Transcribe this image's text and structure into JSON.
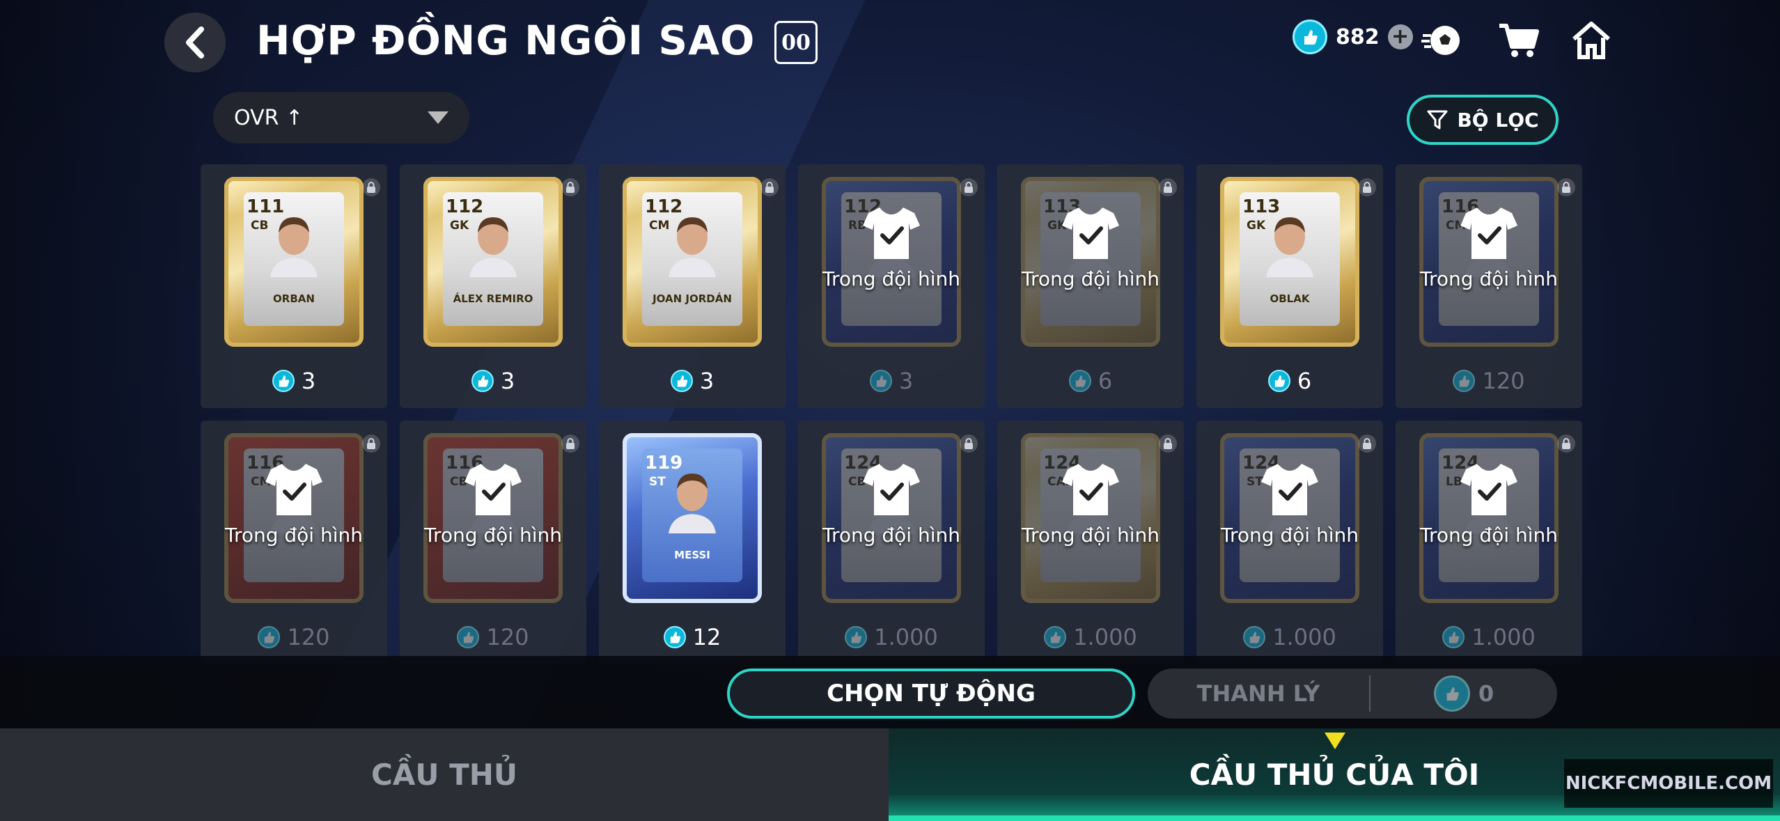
{
  "header": {
    "title": "HỢP ĐỒNG NGÔI SAO",
    "badge": "00",
    "currency_value": "882"
  },
  "sort": {
    "label": "OVR ↑"
  },
  "filter": {
    "label": "BỘ LỌC"
  },
  "in_squad_label": "Trong đội hình",
  "rows": [
    [
      {
        "ovr": "111",
        "pos": "CB",
        "name": "ORBAN",
        "price": "3",
        "in_squad": false,
        "style": "gold"
      },
      {
        "ovr": "112",
        "pos": "GK",
        "name": "ÁLEX REMIRO",
        "price": "3",
        "in_squad": false,
        "style": "gold"
      },
      {
        "ovr": "112",
        "pos": "CM",
        "name": "JOAN JORDÁN",
        "price": "3",
        "in_squad": false,
        "style": "gold"
      },
      {
        "ovr": "112",
        "pos": "RB",
        "name": "",
        "price": "3",
        "in_squad": true,
        "style": "blue"
      },
      {
        "ovr": "113",
        "pos": "GK",
        "name": "",
        "price": "6",
        "in_squad": true,
        "style": "gold"
      },
      {
        "ovr": "113",
        "pos": "GK",
        "name": "OBLAK",
        "price": "6",
        "in_squad": false,
        "style": "gold"
      },
      {
        "ovr": "116",
        "pos": "CM",
        "name": "",
        "price": "120",
        "in_squad": true,
        "style": "blue"
      }
    ],
    [
      {
        "ovr": "116",
        "pos": "CM",
        "name": "",
        "price": "120",
        "in_squad": true,
        "style": "red"
      },
      {
        "ovr": "116",
        "pos": "CB",
        "name": "",
        "price": "120",
        "in_squad": true,
        "style": "red"
      },
      {
        "ovr": "119",
        "pos": "ST",
        "name": "MESSI",
        "price": "12",
        "in_squad": false,
        "style": "messi"
      },
      {
        "ovr": "124",
        "pos": "CB",
        "name": "",
        "price": "1.000",
        "in_squad": true,
        "style": "blue"
      },
      {
        "ovr": "124",
        "pos": "CAM",
        "name": "",
        "price": "1.000",
        "in_squad": true,
        "style": "gold"
      },
      {
        "ovr": "124",
        "pos": "ST",
        "name": "",
        "price": "1.000",
        "in_squad": true,
        "style": "blue"
      },
      {
        "ovr": "124",
        "pos": "LB",
        "name": "",
        "price": "1.000",
        "in_squad": true,
        "style": "blue"
      }
    ]
  ],
  "actions": {
    "auto_select": "CHỌN TỰ ĐỘNG",
    "sell": "THANH LÝ",
    "sell_value": "0"
  },
  "tabs": {
    "players": "CẦU THỦ",
    "my_players": "CẦU THỦ CỦA TÔI"
  },
  "watermark": "NICKFCMOBILE.COM",
  "colors": {
    "accent": "#2fd4c6",
    "coin": "#0bb8dc"
  },
  "icons": [
    "back-arrow-icon",
    "coin-icon",
    "plus-icon",
    "football-icon",
    "cart-icon",
    "home-icon",
    "filter-icon",
    "lock-icon",
    "jersey-check-icon"
  ]
}
